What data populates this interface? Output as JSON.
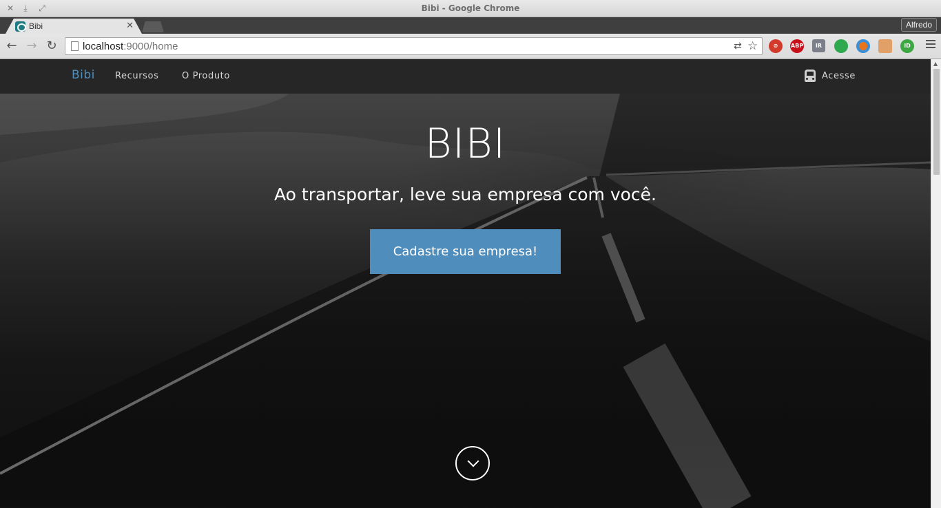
{
  "window": {
    "title": "Bibi - Google Chrome",
    "controls": [
      "close-icon",
      "minimize-icon",
      "maximize-icon"
    ]
  },
  "tabs": [
    {
      "label": "Bibi",
      "favicon": "bibi-favicon-icon",
      "active": true
    }
  ],
  "profile": {
    "name": "Alfredo"
  },
  "toolbar": {
    "url_host": "localhost",
    "url_rest": ":9000/home",
    "extensions": [
      {
        "name": "translate-icon"
      },
      {
        "name": "bookmark-star-icon"
      },
      {
        "name": "extension-red-icon",
        "color": "#d23b2b"
      },
      {
        "name": "adblock-icon",
        "text": "ABP",
        "color": "#c8101a"
      },
      {
        "name": "ir-extension-icon",
        "text": "IR",
        "color": "#7a7f8a"
      },
      {
        "name": "evernote-icon",
        "color": "#2fa94e"
      },
      {
        "name": "color-picker-icon",
        "color": "#e8741c"
      },
      {
        "name": "character-extension-icon",
        "color": "#e0a067"
      },
      {
        "name": "id-extension-icon",
        "text": "ID",
        "color": "#3da743"
      }
    ]
  },
  "site": {
    "brand": "Bibi",
    "nav": [
      "Recursos",
      "O Produto"
    ],
    "login": "Acesse",
    "colors": {
      "accent": "#4f8dbd",
      "navbar": "#262626"
    }
  },
  "hero": {
    "title": "BIBI",
    "subtitle": "Ao transportar, leve sua empresa com você.",
    "cta": "Cadastre sua empresa!",
    "scroll_icon": "chevron-down-icon"
  }
}
